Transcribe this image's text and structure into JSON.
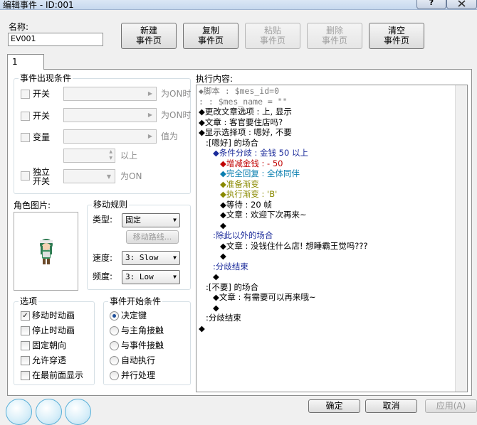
{
  "window": {
    "title": "编辑事件 - ID:001",
    "help_label": "?"
  },
  "name": {
    "label": "名称:",
    "value": "EV001"
  },
  "toolbar": {
    "new": [
      "新建",
      "事件页"
    ],
    "copy": [
      "复制",
      "事件页"
    ],
    "paste": [
      "粘贴",
      "事件页"
    ],
    "delete": [
      "删除",
      "事件页"
    ],
    "clear": [
      "清空",
      "事件页"
    ]
  },
  "tabs": [
    {
      "label": "1"
    }
  ],
  "conditions": {
    "title": "事件出现条件",
    "switch1_label": "开关",
    "switch1_suffix": "为ON时",
    "switch2_label": "开关",
    "switch2_suffix": "为ON时",
    "variable_label": "变量",
    "variable_suffix": "值为",
    "above_label": "以上",
    "self_switch_label": [
      "独立",
      "开关"
    ],
    "self_switch_suffix": "为ON"
  },
  "graphic": {
    "label": "角色图片:"
  },
  "move": {
    "title": "移动规则",
    "type_label": "类型:",
    "type_value": "固定",
    "route_label": "移动路线...",
    "speed_label": "速度:",
    "speed_value": "3: Slow",
    "freq_label": "频度:",
    "freq_value": "3: Low"
  },
  "options": {
    "title": "选项",
    "items": [
      {
        "label": "移动时动画",
        "checked": "✓"
      },
      {
        "label": "停止时动画",
        "checked": ""
      },
      {
        "label": "固定朝向",
        "checked": ""
      },
      {
        "label": "允许穿透",
        "checked": ""
      },
      {
        "label": "在最前面显示",
        "checked": ""
      }
    ]
  },
  "trigger": {
    "title": "事件开始条件",
    "items": [
      {
        "label": "决定键",
        "selected": true
      },
      {
        "label": "与主角接触",
        "selected": false
      },
      {
        "label": "与事件接触",
        "selected": false
      },
      {
        "label": "自动执行",
        "selected": false
      },
      {
        "label": "并行处理",
        "selected": false
      }
    ]
  },
  "content": {
    "label": "执行内容:",
    "lines": [
      {
        "text": "◆脚本 : $mes_id=0",
        "color": "#7a7a7a",
        "indent": 0,
        "mono": true
      },
      {
        "text": "  :      : $mes_name = \"\"",
        "color": "#7a7a7a",
        "indent": 0,
        "mono": true
      },
      {
        "text": "◆更改文章选项 : 上, 显示",
        "color": "#000000",
        "indent": 0
      },
      {
        "text": "◆文章 : 客官要住店吗?",
        "color": "#000000",
        "indent": 0
      },
      {
        "text": "◆显示选择项 : 嗯好, 不要",
        "color": "#000000",
        "indent": 0
      },
      {
        "text": ":[嗯好] 的场合",
        "color": "#000000",
        "indent": 1
      },
      {
        "text": "◆条件分歧 : 金钱 50 以上",
        "color": "#1a2a9a",
        "indent": 2
      },
      {
        "text": "◆增减金钱 : - 50",
        "color": "#c00000",
        "indent": 3
      },
      {
        "text": "◆完全回复 : 全体同伴",
        "color": "#0a7fb0",
        "indent": 3
      },
      {
        "text": "◆准备渐变",
        "color": "#8a8a00",
        "indent": 3
      },
      {
        "text": "◆执行渐变 : 'B'",
        "color": "#8a8a00",
        "indent": 3
      },
      {
        "text": "◆等待 : 20 帧",
        "color": "#000000",
        "indent": 3
      },
      {
        "text": "◆文章 : 欢迎下次再来~",
        "color": "#000000",
        "indent": 3
      },
      {
        "text": "◆",
        "color": "#000000",
        "indent": 3
      },
      {
        "text": ":除此以外的场合",
        "color": "#1a2a9a",
        "indent": 2
      },
      {
        "text": "◆文章 : 没钱住什么店! 想睡霸王觉吗???",
        "color": "#000000",
        "indent": 3
      },
      {
        "text": "◆",
        "color": "#000000",
        "indent": 3
      },
      {
        "text": ":分歧结束",
        "color": "#1a2a9a",
        "indent": 2
      },
      {
        "text": "◆",
        "color": "#000000",
        "indent": 2
      },
      {
        "text": ":[不要] 的场合",
        "color": "#000000",
        "indent": 1
      },
      {
        "text": "◆文章 : 有需要可以再来哦~",
        "color": "#000000",
        "indent": 2
      },
      {
        "text": "◆",
        "color": "#000000",
        "indent": 2
      },
      {
        "text": ":分歧结束",
        "color": "#000000",
        "indent": 1
      },
      {
        "text": "◆",
        "color": "#000000",
        "indent": 0
      }
    ]
  },
  "footer": {
    "ok": "确定",
    "cancel": "取消",
    "apply": "应用(A)"
  }
}
